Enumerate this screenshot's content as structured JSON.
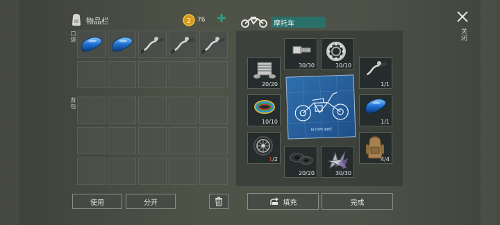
{
  "inventory": {
    "title": "物品栏",
    "coin_count": "76",
    "pocket_label": "口袋",
    "backpack_label": "背包",
    "pocket_items": [
      {
        "icon": "fuel-tank-icon"
      },
      {
        "icon": "fuel-tank-icon"
      },
      {
        "icon": "handlebar-icon"
      },
      {
        "icon": "handlebar-icon"
      },
      {
        "icon": "handlebar-icon"
      }
    ],
    "use_label": "使用",
    "split_label": "分开"
  },
  "crafting": {
    "title": "摩托车",
    "parts": [
      {
        "icon": "engine-icon",
        "count": "20/20"
      },
      {
        "icon": "bolt-icon",
        "count": "30/30"
      },
      {
        "icon": "bearing-icon",
        "count": "10/10"
      },
      {
        "icon": "handlebar-icon",
        "count": "1/1"
      },
      {
        "icon": "wires-icon",
        "count": "10/10"
      },
      {
        "icon": "fuel-tank-icon",
        "count": "1/1"
      },
      {
        "icon": "wheel-icon",
        "count": "1",
        "count_total": "/2"
      },
      {
        "icon": "gasket-icon",
        "count": "20/20"
      },
      {
        "icon": "metal-scraps-icon",
        "count": "30/30"
      },
      {
        "icon": "backpack-icon",
        "count": "4/4"
      }
    ],
    "blueprint_caption": "M-TYPE  BIKE",
    "fill_label": "填充",
    "complete_label": "完成"
  },
  "close_label": "关闭",
  "colors": {
    "accent": "#2f8c8a",
    "tank_blue": "#1e6fd0",
    "missing_red": "#e24a3a",
    "coin": "#d99a1c"
  }
}
